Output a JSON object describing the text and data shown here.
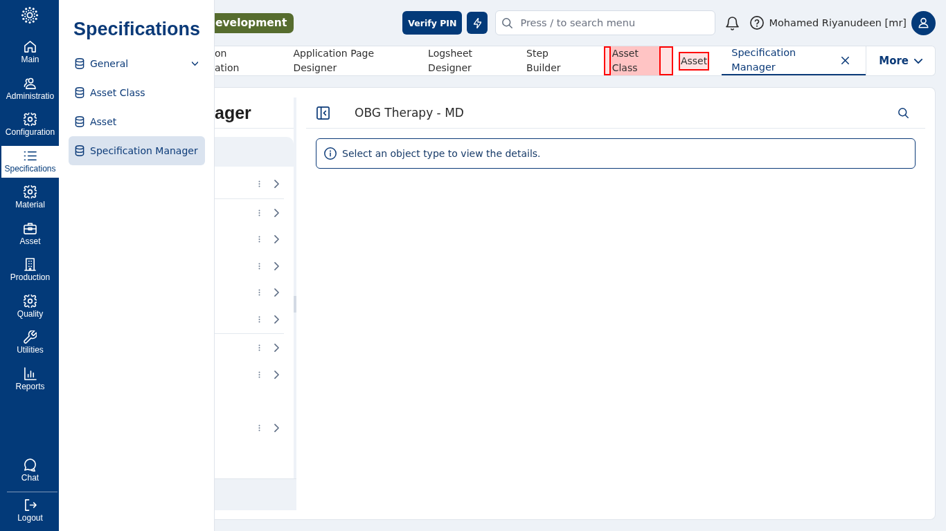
{
  "nav_rail": {
    "items": [
      {
        "label": "Main",
        "selected": false
      },
      {
        "label": "Administratio",
        "selected": false
      },
      {
        "label": "Configuration",
        "selected": false
      },
      {
        "label": "Specifications",
        "selected": true
      },
      {
        "label": "Material",
        "selected": false
      },
      {
        "label": "Asset",
        "selected": false
      },
      {
        "label": "Production",
        "selected": false
      },
      {
        "label": "Quality",
        "selected": false
      },
      {
        "label": "Utilities",
        "selected": false
      },
      {
        "label": "Reports",
        "selected": false
      }
    ],
    "bottom_items": [
      {
        "label": "Chat"
      },
      {
        "label": "Logout"
      }
    ]
  },
  "flyout": {
    "title": "Specifications",
    "items": [
      {
        "label": "General",
        "kind": "group",
        "expanded": false,
        "selected": false
      },
      {
        "label": "Asset Class",
        "kind": "page",
        "selected": false
      },
      {
        "label": "Asset",
        "kind": "page",
        "selected": false
      },
      {
        "label": "Specification Manager",
        "kind": "page",
        "selected": true
      }
    ]
  },
  "top_bar": {
    "environment_badge": "evelopment",
    "verify_pin_button": "Verify PIN",
    "search": {
      "placeholder": "Press / to search menu"
    },
    "user_name": "Mohamed Riyanudeen [mr]"
  },
  "tabs": {
    "items": [
      {
        "label": "on\nation",
        "selected": false,
        "tab_outlined": false,
        "label_outlined": false
      },
      {
        "label": "Application Page\nDesigner",
        "selected": false,
        "tab_outlined": false,
        "label_outlined": false
      },
      {
        "label": "Logsheet\nDesigner",
        "selected": false,
        "tab_outlined": false,
        "label_outlined": false
      },
      {
        "label": "Step\nBuilder",
        "selected": false,
        "tab_outlined": false,
        "label_outlined": false
      },
      {
        "label": "Asset\nClass",
        "selected": false,
        "tab_outlined": true,
        "label_outlined": true
      },
      {
        "label": "Asset",
        "selected": false,
        "tab_outlined": false,
        "label_outlined": true
      },
      {
        "label": "Specification\nManager",
        "selected": true,
        "tab_outlined": false,
        "label_outlined": false
      }
    ],
    "more_button": "More"
  },
  "list_panel": {
    "title": "ager",
    "rows": [
      {
        "kind": "band"
      },
      {
        "kind": "item"
      },
      {
        "kind": "divider"
      },
      {
        "kind": "item"
      },
      {
        "kind": "item"
      },
      {
        "kind": "item"
      },
      {
        "kind": "item"
      },
      {
        "kind": "item"
      },
      {
        "kind": "divider"
      },
      {
        "kind": "item"
      },
      {
        "kind": "item"
      },
      {
        "kind": "blank"
      },
      {
        "kind": "item"
      }
    ]
  },
  "detail_panel": {
    "title": "OBG Therapy - MD",
    "message": "Select an object type to view the details."
  }
}
